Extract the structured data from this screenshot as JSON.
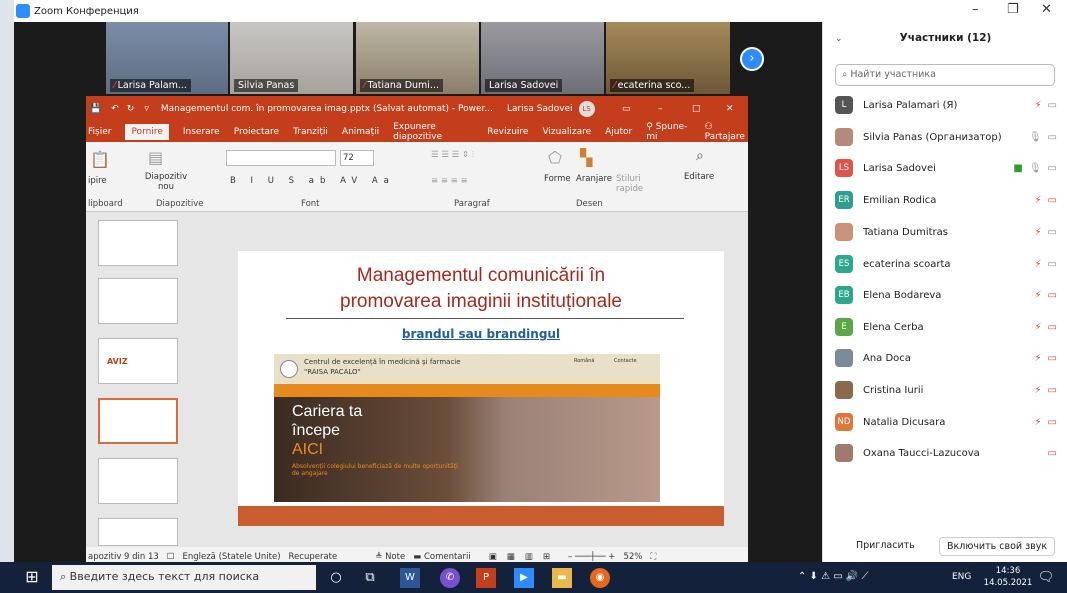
{
  "zoom": {
    "title": "Zoom Конференция"
  },
  "thumbs": [
    {
      "name": "Larisa Palam..."
    },
    {
      "name": "Silvia Panas"
    },
    {
      "name": "Tatiana Dumi..."
    },
    {
      "name": "Larisa Sadovei"
    },
    {
      "name": "ecaterina sco..."
    }
  ],
  "ppt": {
    "doc_title": "Managementul com. în promovarea imag.pptx  (Salvat automat)  -  Power...",
    "user": "Larisa Sadovei",
    "user_initials": "LS",
    "tabs": [
      "Fișier",
      "Pornire",
      "Inserare",
      "Proiectare",
      "Tranziții",
      "Animații",
      "Expunere diapozitive",
      "Revizuire",
      "Vizualizare",
      "Ajutor",
      "Spune-mi",
      "Partajare"
    ],
    "groups": [
      "lipboard",
      "Diapozitive",
      "Font",
      "Paragraf",
      "Desen"
    ],
    "ribbon": {
      "new_slide": "Diapozitiv nou",
      "forms": "Forme",
      "arrange": "Aranjare",
      "styles": "Stiluri rapide",
      "edit": "Editare",
      "font_size": "72",
      "paste": "ipire"
    },
    "slide": {
      "title1": "Managementul comunicării în",
      "title2": "promovarea imaginii instituționale",
      "subtitle": "brandul sau brandingul",
      "web_name1": "Centrul de excelență în medicină și farmacie",
      "web_name2": "\"RAISA  PACALO\"",
      "web_lang": "Română",
      "web_contact": "Contacte",
      "hero1": "Cariera ta",
      "hero2": "începe",
      "hero3": "AICI",
      "hero_sub": "Absolvenții colegiului beneficiază de multe oportunități de angajare"
    },
    "thumb_titles": [
      "AVIZ"
    ],
    "status": {
      "slide": "apozitiv 9 din 13",
      "lang": "Engleză (Statele Unite)",
      "recovered": "Recuperate",
      "notes": "Note",
      "comments": "Comentarii",
      "zoom": "52%"
    }
  },
  "panel": {
    "title": "Участники (12)",
    "search_placeholder": "Найти участника",
    "participants": [
      {
        "name": "Larisa Palamari (Я)",
        "initials": "L",
        "color": "#555555"
      },
      {
        "name": "Silvia Panas (Организатор)",
        "initials": "",
        "color": "#b58a7a"
      },
      {
        "name": "Larisa Sadovei",
        "initials": "LS",
        "color": "#e0534a"
      },
      {
        "name": "Emilian Rodica",
        "initials": "ER",
        "color": "#2e9e8f"
      },
      {
        "name": "Tatiana Dumitras",
        "initials": "",
        "color": "#c9937a"
      },
      {
        "name": "ecaterina scoarta",
        "initials": "ES",
        "color": "#2ea88a"
      },
      {
        "name": "Elena Bodareva",
        "initials": "EB",
        "color": "#2ea88a"
      },
      {
        "name": "Elena Cerba",
        "initials": "E",
        "color": "#5aa845"
      },
      {
        "name": "Ana Doca",
        "initials": "",
        "color": "#7a8a9a"
      },
      {
        "name": "Cristina Iurii",
        "initials": "",
        "color": "#8a6a4a"
      },
      {
        "name": "Natalia Dicusara",
        "initials": "ND",
        "color": "#e0773a"
      },
      {
        "name": "Oxana Taucci-Lazucova",
        "initials": "",
        "color": "#a07a6a"
      }
    ],
    "invite": "Пригласить",
    "unmute": "Включить свой звук"
  },
  "taskbar": {
    "search": "Введите здесь текст для поиска",
    "lang": "ENG",
    "time": "14:36",
    "date": "14.05.2021"
  }
}
